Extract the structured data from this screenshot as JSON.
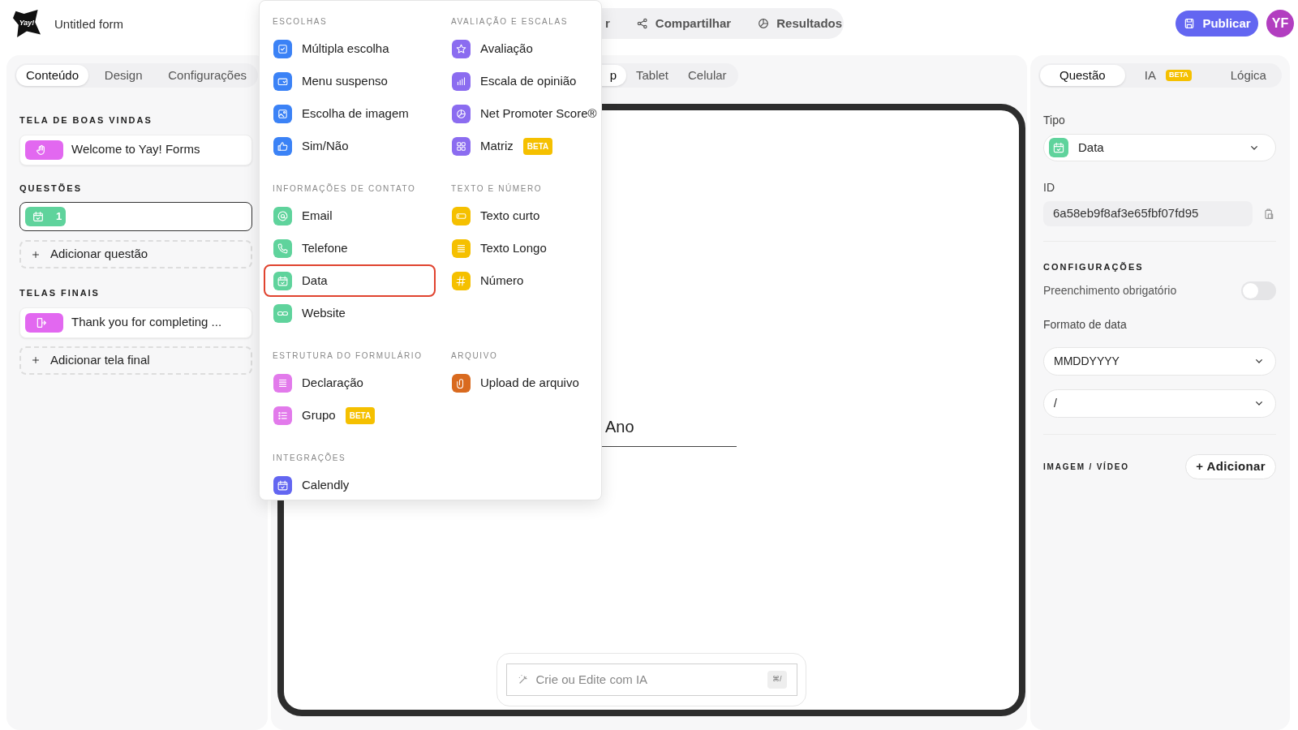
{
  "header": {
    "logo_text": "Yay!",
    "title": "Untitled form",
    "nav": [
      {
        "label": "r",
        "kind": "none"
      },
      {
        "label": "Compartilhar",
        "kind": "share"
      },
      {
        "label": "Resultados",
        "kind": "chart"
      }
    ],
    "publish": "Publicar",
    "avatar": "YF"
  },
  "left_panel": {
    "tabs": [
      {
        "label": "Conteúdo",
        "selected": true
      },
      {
        "label": "Design",
        "selected": false
      },
      {
        "label": "Configurações",
        "selected": false
      }
    ],
    "welcome_heading": "TELA DE BOAS VINDAS",
    "welcome_item": "Welcome to Yay! Forms",
    "questions_heading": "QUESTÕES",
    "questions": [
      {
        "number": "1",
        "selected": true
      }
    ],
    "add_question": "Adicionar questão",
    "endings_heading": "TELAS FINAIS",
    "ending_item": "Thank you for completing ...",
    "add_ending": "Adicionar tela final"
  },
  "preview": {
    "device_tabs": [
      {
        "label": "p",
        "selected": true
      },
      {
        "label": "Tablet",
        "selected": false
      },
      {
        "label": "Celular",
        "selected": false
      }
    ],
    "field_label": "Ano",
    "ai_placeholder": "Crie ou Edite com IA",
    "ai_shortcut": "⌘/"
  },
  "menu": {
    "groups": [
      {
        "heading": "ESCOLHAS",
        "items": [
          {
            "label": "Múltipla escolha",
            "kind": "check",
            "color": "#3b82f6",
            "selected": false
          },
          {
            "label": "Menu suspenso",
            "kind": "dropdown",
            "color": "#3b82f6",
            "selected": false
          },
          {
            "label": "Escolha de imagem",
            "kind": "image",
            "color": "#3b82f6",
            "selected": false
          },
          {
            "label": "Sim/Não",
            "kind": "thumb",
            "color": "#3b82f6",
            "selected": false
          }
        ]
      },
      {
        "heading": "AVALIAÇÃO E ESCALAS",
        "items": [
          {
            "label": "Avaliação",
            "kind": "star",
            "color": "#8b6cf0",
            "selected": false
          },
          {
            "label": "Escala de opinião",
            "kind": "bars",
            "color": "#8b6cf0",
            "selected": false
          },
          {
            "label": "Net Promoter Score®",
            "kind": "pie",
            "color": "#8b6cf0",
            "selected": false
          },
          {
            "label": "Matriz",
            "kind": "grid",
            "color": "#8b6cf0",
            "badge": "BETA",
            "selected": false
          }
        ]
      },
      {
        "heading": "INFORMAÇÕES DE CONTATO",
        "items": [
          {
            "label": "Email",
            "kind": "at",
            "color": "#5fd39c",
            "selected": false
          },
          {
            "label": "Telefone",
            "kind": "phone",
            "color": "#5fd39c",
            "selected": false
          },
          {
            "label": "Data",
            "kind": "calendar",
            "color": "#5fd39c",
            "selected": true
          },
          {
            "label": "Website",
            "kind": "link",
            "color": "#5fd39c",
            "selected": false
          }
        ]
      },
      {
        "heading": "TEXTO E NÚMERO",
        "items": [
          {
            "label": "Texto curto",
            "kind": "short",
            "color": "#f5c000",
            "selected": false
          },
          {
            "label": "Texto Longo",
            "kind": "lines",
            "color": "#f5c000",
            "selected": false
          },
          {
            "label": "Número",
            "kind": "hash",
            "color": "#f5c000",
            "selected": false
          }
        ]
      },
      {
        "heading": "ESTRUTURA DO FORMULÁRIO",
        "items": [
          {
            "label": "Declaração",
            "kind": "lines",
            "color": "#e27aeb",
            "selected": false
          },
          {
            "label": "Grupo",
            "kind": "list",
            "color": "#e27aeb",
            "badge": "BETA",
            "selected": false
          }
        ]
      },
      {
        "heading": "ARQUIVO",
        "items": [
          {
            "label": "Upload de arquivo",
            "kind": "clip",
            "color": "#d96a1f",
            "selected": false
          }
        ]
      },
      {
        "heading": "INTEGRAÇÕES",
        "items": [
          {
            "label": "Calendly",
            "kind": "calendar",
            "color": "#6366f1",
            "selected": false
          }
        ]
      }
    ]
  },
  "right_panel": {
    "tabs": [
      {
        "label": "Questão",
        "selected": true
      },
      {
        "label": "IA",
        "badge": "BETA",
        "selected": false
      },
      {
        "label": "Lógica",
        "selected": false
      }
    ],
    "type_label": "Tipo",
    "type_value": "Data",
    "id_label": "ID",
    "id_value": "6a58eb9f8af3e65fbf07fd95",
    "settings_heading": "CONFIGURAÇÕES",
    "required": {
      "label": "Preenchimento obrigatório",
      "on": false
    },
    "format_label": "Formato de data",
    "format_value": "MMDDYYYY",
    "separator_value": "/",
    "media_heading": "IMAGEM / VÍDEO",
    "add_media": "+ Adicionar"
  }
}
